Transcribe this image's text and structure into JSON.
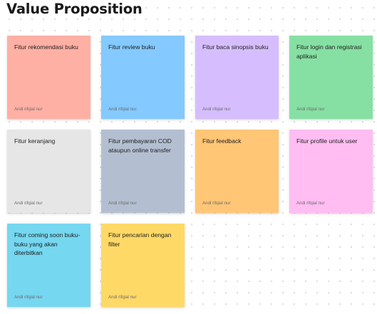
{
  "board": {
    "title": "Value Proposition"
  },
  "notes": [
    {
      "text": "Fitur rekomendasi buku",
      "author": "Andi rifqial nur",
      "color": "#ffb0a4"
    },
    {
      "text": "Fitur review buku",
      "author": "Andi rifqial nur",
      "color": "#84c9ff"
    },
    {
      "text": "Fitur baca sinopsis buku",
      "author": "Andi rifqial nur",
      "color": "#d6befe"
    },
    {
      "text": "Fitur login dan registrasi aplikasi",
      "author": "Andi rifqial nur",
      "color": "#86e0a3"
    },
    {
      "text": "Fitur keranjang",
      "author": "Andi rifqial nur",
      "color": "#e6e6e6"
    },
    {
      "text": "Fitur pembayaran COD ataupun online transfer",
      "author": "Andi rifqial nur",
      "color": "#b3bfd1"
    },
    {
      "text": "Fitur feedback",
      "author": "Andi rifqial nur",
      "color": "#ffc676"
    },
    {
      "text": "Fitur profile untuk user",
      "author": "Andi rifqial nur",
      "color": "#ffbdf2"
    },
    {
      "text": "Fitur coming soon buku-buku yang akan diterbitkan",
      "author": "Andi rifqial nur",
      "color": "#75d7f0"
    },
    {
      "text": "Fitur pencarian dengan filter",
      "author": "Andi rifqial nur",
      "color": "#ffd966"
    }
  ]
}
